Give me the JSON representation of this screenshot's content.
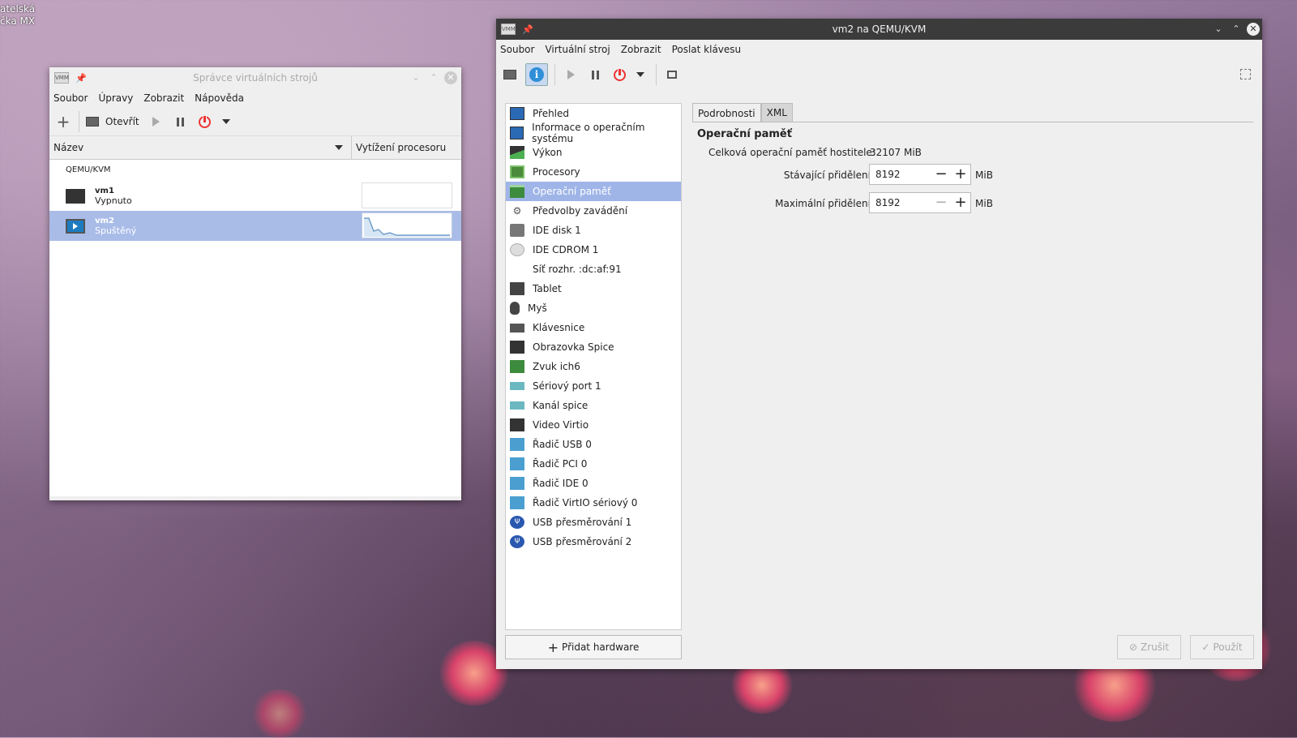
{
  "desktop": {
    "label_line1": "atelská",
    "label_line2": "čka MX"
  },
  "manager": {
    "title": "Správce virtuálních strojů",
    "menu": [
      "Soubor",
      "Úpravy",
      "Zobrazit",
      "Nápověda"
    ],
    "toolbar": {
      "open_label": "Otevřít"
    },
    "columns": {
      "name": "Název",
      "cpu": "Vytížení procesoru"
    },
    "group": "QEMU/KVM",
    "vms": [
      {
        "name": "vm1",
        "state": "Vypnuto"
      },
      {
        "name": "vm2",
        "state": "Spuštěný"
      }
    ]
  },
  "vmwin": {
    "title": "vm2 na QEMU/KVM",
    "menu": [
      "Soubor",
      "Virtuální stroj",
      "Zobrazit",
      "Poslat klávesu"
    ],
    "hardware": [
      {
        "label": "Přehled",
        "icon": "monitor-icon"
      },
      {
        "label": "Informace o operačním systému",
        "icon": "monitor-icon"
      },
      {
        "label": "Výkon",
        "icon": "chart-icon"
      },
      {
        "label": "Procesory",
        "icon": "chip-icon"
      },
      {
        "label": "Operační paměť",
        "icon": "memory-icon"
      },
      {
        "label": "Předvolby zavádění",
        "icon": "gear-icon"
      },
      {
        "label": "IDE disk 1",
        "icon": "disk-icon"
      },
      {
        "label": "IDE CDROM 1",
        "icon": "cdrom-icon"
      },
      {
        "label": "Síť rozhr. :dc:af:91",
        "icon": "network-icon"
      },
      {
        "label": "Tablet",
        "icon": "tablet-icon"
      },
      {
        "label": "Myš",
        "icon": "mouse-icon"
      },
      {
        "label": "Klávesnice",
        "icon": "keyboard-icon"
      },
      {
        "label": "Obrazovka Spice",
        "icon": "display-icon"
      },
      {
        "label": "Zvuk ich6",
        "icon": "sound-icon"
      },
      {
        "label": "Sériový port 1",
        "icon": "serial-icon"
      },
      {
        "label": "Kanál spice",
        "icon": "channel-icon"
      },
      {
        "label": "Video Virtio",
        "icon": "video-icon"
      },
      {
        "label": "Řadič USB 0",
        "icon": "controller-icon"
      },
      {
        "label": "Řadič PCI 0",
        "icon": "controller-icon"
      },
      {
        "label": "Řadič IDE 0",
        "icon": "controller-icon"
      },
      {
        "label": "Řadič VirtIO sériový 0",
        "icon": "controller-icon"
      },
      {
        "label": "USB přesměrování 1",
        "icon": "usb-icon"
      },
      {
        "label": "USB přesměrování 2",
        "icon": "usb-icon"
      }
    ],
    "selected_index": 4,
    "add_hardware": "Přidat hardware",
    "tabs": [
      "Podrobnosti",
      "XML"
    ],
    "section_title": "Operační paměť",
    "host_memory_label": "Celková operační paměť hostitele:",
    "host_memory_value": "32107 MiB",
    "current_label": "Stávající přidělení:",
    "current_value": "8192",
    "max_label": "Maximální přidělení:",
    "max_value": "8192",
    "unit": "MiB",
    "cancel": "Zrušit",
    "apply": "Použít"
  }
}
